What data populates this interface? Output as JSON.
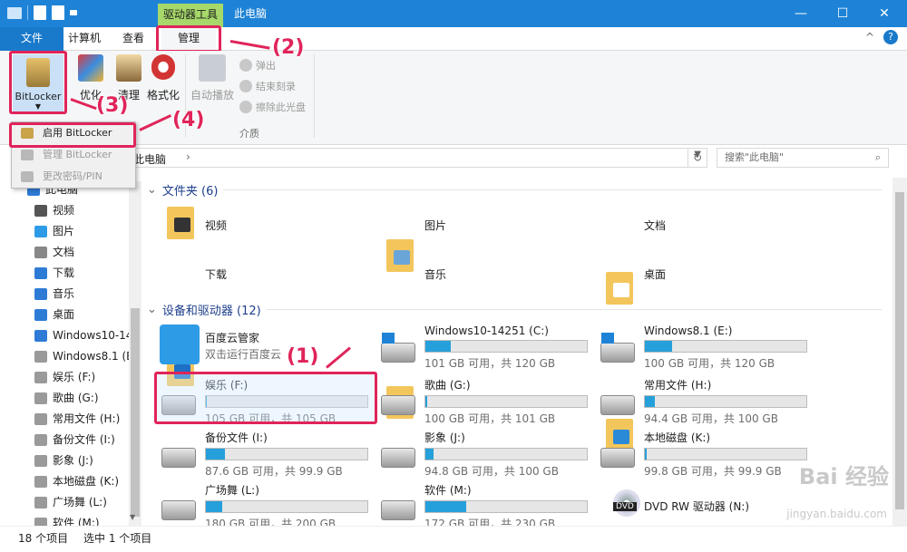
{
  "window": {
    "tool_tab": "驱动器工具",
    "title": "此电脑",
    "min": "—",
    "max": "☐",
    "close": "✕"
  },
  "menu": {
    "file": "文件",
    "computer": "计算机",
    "view": "查看",
    "manage": "管理",
    "collapse": "^",
    "help": "?"
  },
  "ribbon": {
    "bitlocker": "BitLocker",
    "optimize": "优化",
    "cleanup": "清理",
    "format": "格式化",
    "autoplay": "自动播放",
    "eject": "弹出",
    "finish_burn": "结束刻录",
    "erase_disc": "擦除此光盘",
    "media_group": "介质"
  },
  "dropdown": {
    "enable": "启用 BitLocker",
    "manage": "管理 BitLocker",
    "change_pin": "更改密码/PIN"
  },
  "callouts": {
    "c1": "(1)",
    "c2": "(2)",
    "c3": "(3)",
    "c4": "(4)"
  },
  "address": {
    "path": "此电脑",
    "chevron": "›",
    "search_placeholder": "搜索\"此电脑\""
  },
  "nav": {
    "items": [
      "此电脑",
      "视频",
      "图片",
      "文档",
      "下载",
      "音乐",
      "桌面",
      "Windows10-14",
      "Windows8.1 (E",
      "娱乐 (F:)",
      "歌曲 (G:)",
      "常用文件 (H:)",
      "备份文件 (I:)",
      "影象 (J:)",
      "本地磁盘 (K:)",
      "广场舞 (L:)",
      "软件 (M:)"
    ]
  },
  "content": {
    "folders_header": "文件夹 (6)",
    "folders": [
      "视频",
      "图片",
      "文档",
      "下载",
      "音乐",
      "桌面"
    ],
    "drives_header": "设备和驱动器 (12)",
    "baidu": {
      "name": "百度云管家",
      "sub": "双击运行百度云"
    },
    "drives": [
      {
        "name": "Windows10-14251 (C:)",
        "sub": "101 GB 可用，共 120 GB",
        "used": 0.16
      },
      {
        "name": "Windows8.1 (E:)",
        "sub": "100 GB 可用，共 120 GB",
        "used": 0.17
      },
      {
        "name": "娱乐 (F:)",
        "sub": "105 GB 可用，共 105 GB",
        "used": 0.0
      },
      {
        "name": "歌曲 (G:)",
        "sub": "100 GB 可用，共 101 GB",
        "used": 0.01
      },
      {
        "name": "常用文件 (H:)",
        "sub": "94.4 GB 可用，共 100 GB",
        "used": 0.06
      },
      {
        "name": "备份文件 (I:)",
        "sub": "87.6 GB 可用，共 99.9 GB",
        "used": 0.12
      },
      {
        "name": "影象 (J:)",
        "sub": "94.8 GB 可用，共 100 GB",
        "used": 0.05
      },
      {
        "name": "本地磁盘 (K:)",
        "sub": "99.8 GB 可用，共 99.9 GB",
        "used": 0.01
      },
      {
        "name": "广场舞 (L:)",
        "sub": "180 GB 可用，共 200 GB",
        "used": 0.1
      },
      {
        "name": "软件 (M:)",
        "sub": "172 GB 可用，共 230 GB",
        "used": 0.25
      }
    ],
    "dvd": {
      "name": "DVD RW 驱动器 (N:)"
    }
  },
  "status": {
    "count": "18 个项目",
    "selected": "选中 1 个项目"
  },
  "watermark": {
    "text": "Bai 经验",
    "url": "jingyan.baidu.com"
  },
  "colors": {
    "accent": "#1e83d6",
    "callout": "#e0245a",
    "tool_tab": "#a6d86a",
    "bar": "#26a0da"
  }
}
